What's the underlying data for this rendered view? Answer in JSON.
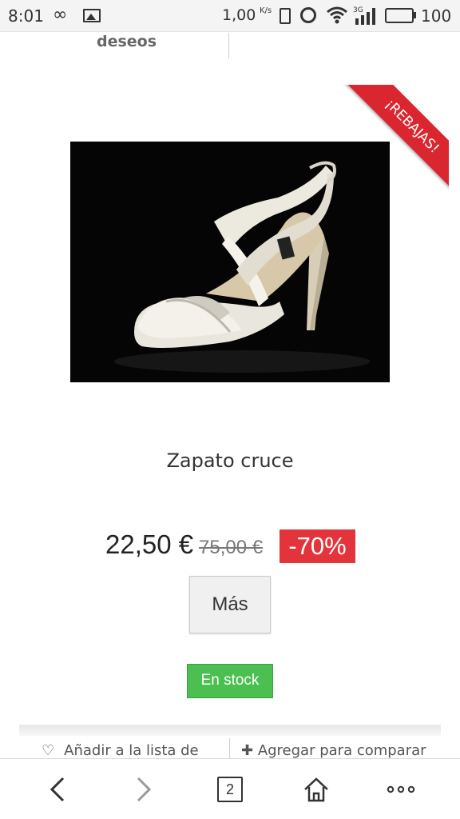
{
  "status_bar": {
    "time": "8:01",
    "speed": "1,00",
    "speed_unit": "K/s",
    "network_type": "3G",
    "battery": "100",
    "icons": [
      "infinity-icon",
      "image-icon",
      "vibrate-icon",
      "alarm-icon",
      "wifi-icon",
      "signal-icon",
      "battery-icon"
    ]
  },
  "top_tabs": {
    "wishlist_partial": "deseos"
  },
  "product": {
    "ribbon": "¡REBAJAS!",
    "name": "Zapato cruce",
    "price": "22,50 €",
    "old_price": "75,00 €",
    "discount": "-70%",
    "more_label": "Más",
    "stock": "En stock"
  },
  "actions": {
    "wishlist_label": "Añadir a la lista de",
    "compare_label": "Agregar para comparar"
  },
  "browser_nav": {
    "tab_count": "2",
    "icons": [
      "back-icon",
      "forward-icon",
      "tabs-icon",
      "home-icon",
      "more-icon"
    ]
  },
  "colors": {
    "sale_red": "#d9262f",
    "discount_red": "#e3333b",
    "stock_green": "#4bbf4f"
  }
}
